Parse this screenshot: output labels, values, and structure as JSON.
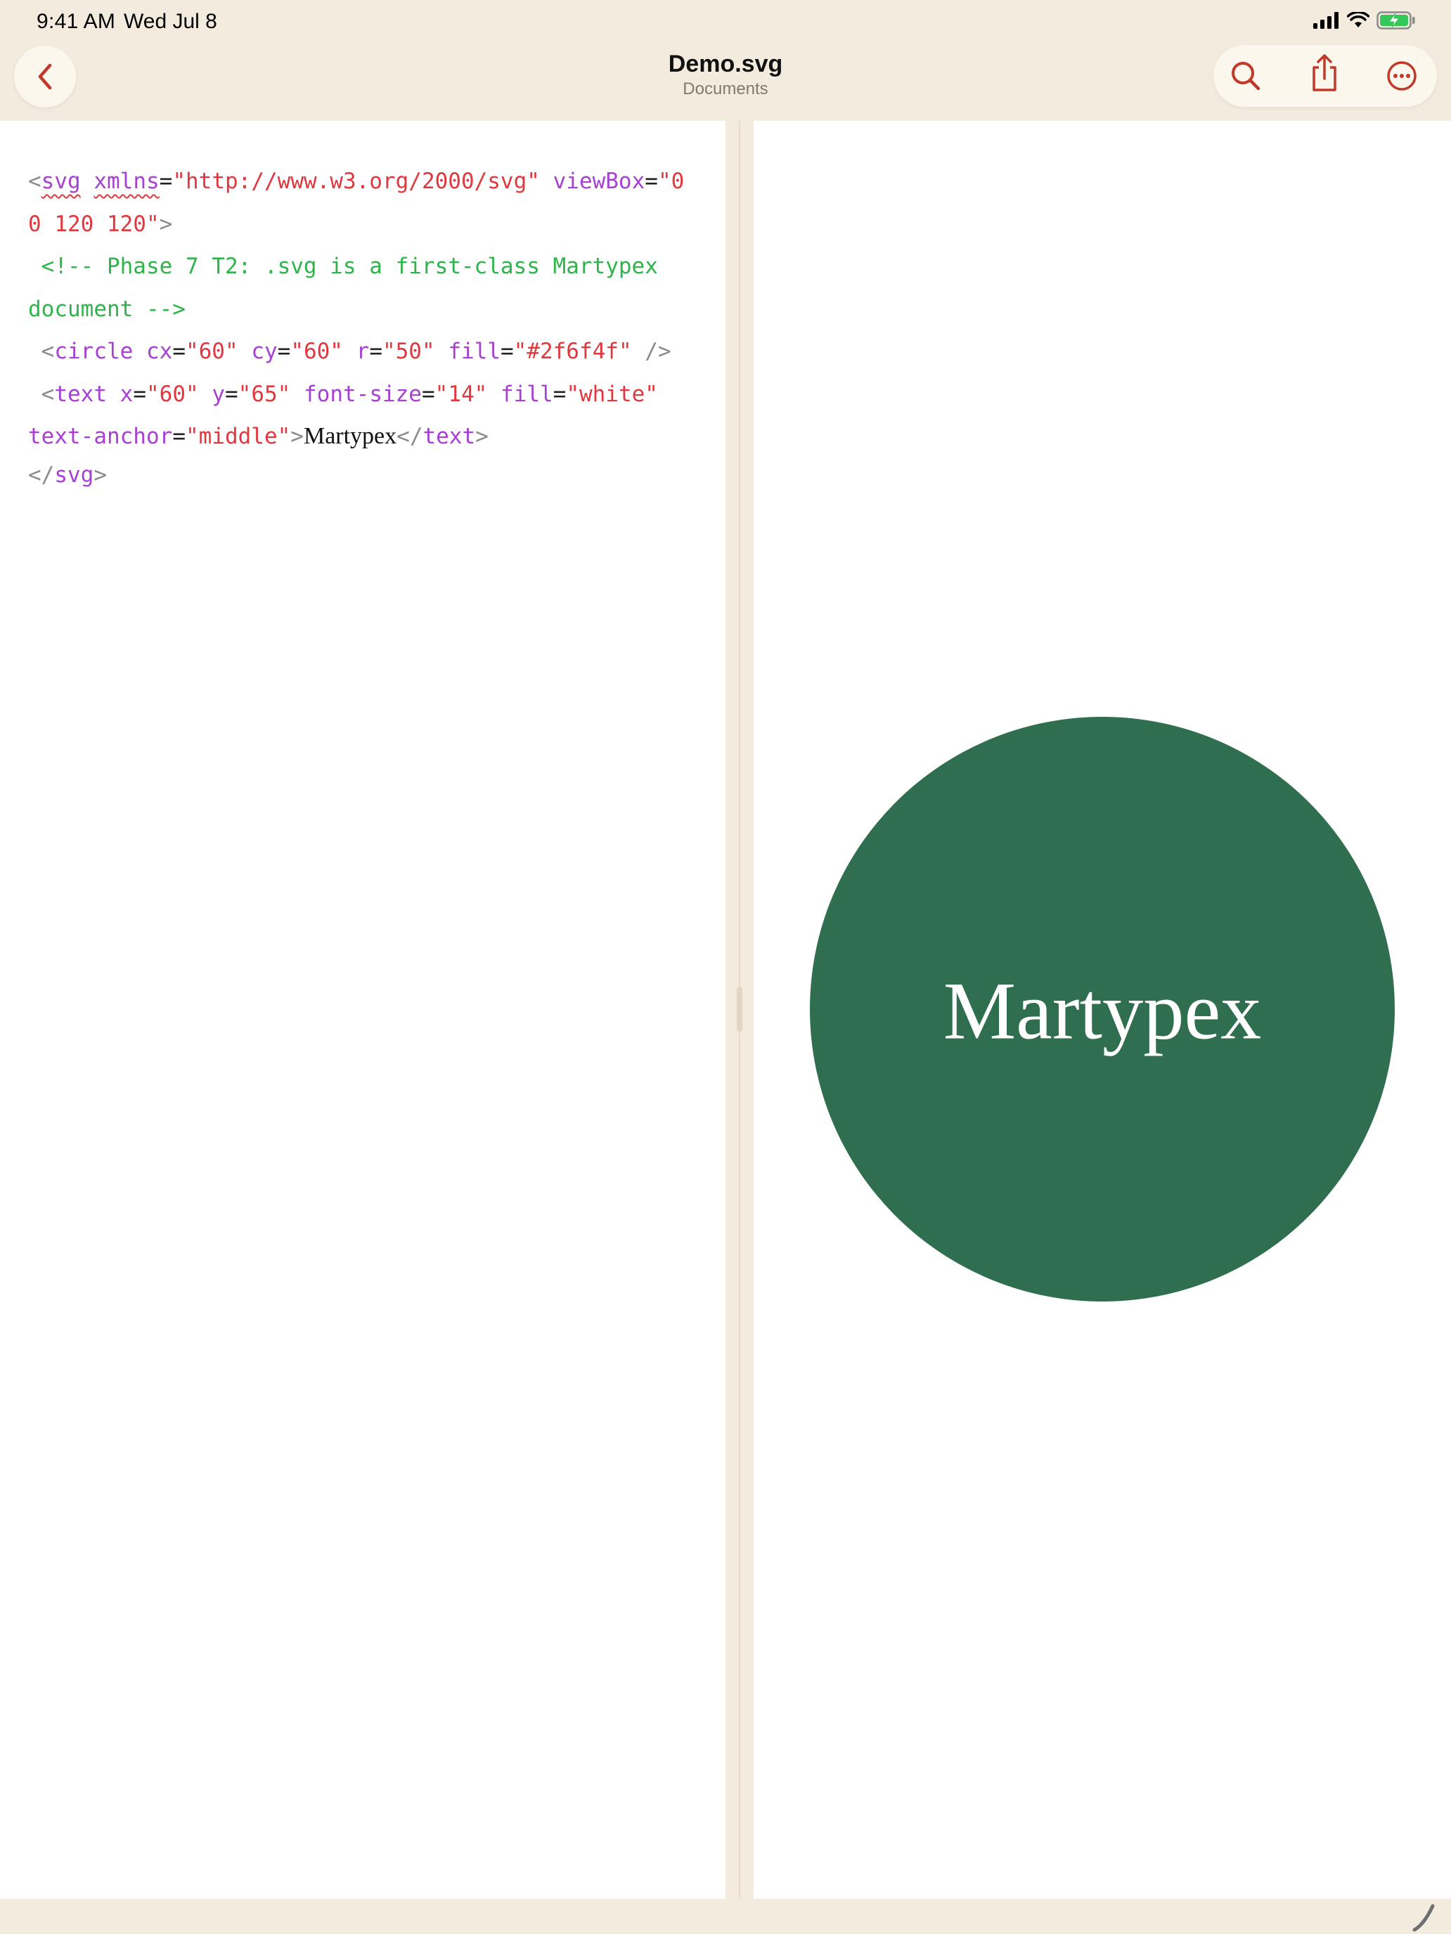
{
  "status_bar": {
    "time": "9:41 AM",
    "date": "Wed Jul 8"
  },
  "nav": {
    "title": "Demo.svg",
    "subtitle": "Documents",
    "accent_color": "#C0392B"
  },
  "icons": {
    "back": "chevron-left-icon",
    "search": "magnifying-glass-icon",
    "share": "share-icon",
    "more": "ellipsis-circle-icon",
    "pencil": "pencil-icon"
  },
  "code": {
    "line1": {
      "open": "<",
      "tag": "svg",
      "attr1": "xmlns",
      "eq1": "=",
      "val1": "\"http://www.w3.org/2000/svg\"",
      "attr2": "viewBox",
      "eq2": "=",
      "val2a": "\"0",
      "val2b": "0 120 120\"",
      "close": ">"
    },
    "comment_a": " <!-- Phase 7 T2: .svg is a first-class Martypex",
    "comment_b": "document -->",
    "line3": {
      "open": " <",
      "tag": "circle",
      "attr_cx": "cx",
      "eq": "=",
      "val_cx": "\"60\"",
      "attr_cy": "cy",
      "val_cy": "\"60\"",
      "attr_r": "r",
      "val_r": "\"50\"",
      "attr_fill": "fill",
      "val_fill": "\"#2f6f4f\"",
      "close": " />"
    },
    "line4": {
      "open": " <",
      "tag": "text",
      "attr_x": "x",
      "eq": "=",
      "val_x": "\"60\"",
      "attr_y": "y",
      "val_y": "\"65\"",
      "attr_fs": "font-size",
      "val_fs": "\"14\"",
      "attr_fill": "fill",
      "val_fill": "\"white\"",
      "attr_anchor": "text-anchor",
      "val_anchor": "\"middle\"",
      "gt": ">",
      "content": "Martypex",
      "end_open": "</",
      "end_tag": "text",
      "end_close": ">"
    },
    "line5": {
      "open": "</",
      "tag": "svg",
      "close": ">"
    }
  },
  "preview": {
    "circle_fill": "#2f6f4f",
    "text": "Martypex",
    "text_fill": "white"
  }
}
